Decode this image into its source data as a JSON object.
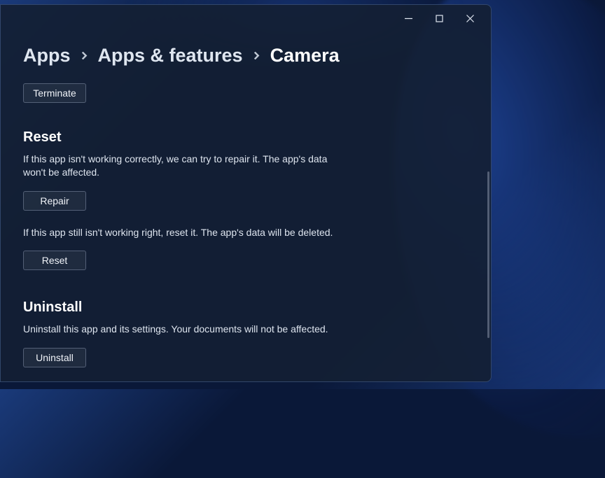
{
  "breadcrumb": {
    "root": "Apps",
    "parent": "Apps & features",
    "current": "Camera"
  },
  "terminate": {
    "button": "Terminate"
  },
  "reset": {
    "title": "Reset",
    "repair_desc": "If this app isn't working correctly, we can try to repair it. The app's data won't be affected.",
    "repair_button": "Repair",
    "reset_desc": "If this app still isn't working right, reset it. The app's data will be deleted.",
    "reset_button": "Reset"
  },
  "uninstall": {
    "title": "Uninstall",
    "desc": "Uninstall this app and its settings. Your documents will not be affected.",
    "button": "Uninstall"
  }
}
